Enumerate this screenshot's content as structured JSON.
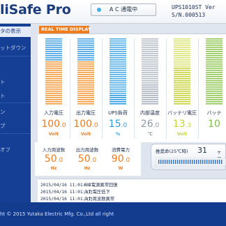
{
  "header": {
    "app_title": "liSafe Pro",
    "mode": "A C 通電中",
    "model_line1": "UPS1010ST  Ver",
    "model_line2": "S/N.000513"
  },
  "sidebar": {
    "items": [
      {
        "label": "タの表示",
        "active": true
      },
      {
        "label": "ットダウン",
        "active": false
      },
      {
        "label": "ト",
        "active": false
      },
      {
        "label": "ト",
        "active": false
      },
      {
        "label": "ン",
        "active": false
      },
      {
        "label": "プ",
        "active": false
      },
      {
        "label": "オフ",
        "active": false
      }
    ]
  },
  "realtime": {
    "title": "REAL TIME DISPLAY",
    "meters": [
      {
        "label": "入力電圧",
        "whole": "100",
        "dec": ".0",
        "unit": "Volt",
        "level": 0.66,
        "color": "#ef7b1c",
        "filled": "#f29a3b",
        "empty": "#1f8fdd"
      },
      {
        "label": "出力電圧",
        "whole": "100",
        "dec": ".0",
        "unit": "Volt",
        "level": 0.66,
        "color": "#ef7b1c",
        "filled": "#f29a3b",
        "empty": "#1f8fdd"
      },
      {
        "label": "UPS負荷",
        "whole": "15",
        "dec": ".0",
        "unit": "%",
        "level": 0.15,
        "color": "#2a9be0",
        "filled": "#2a9be0",
        "empty": "#2a9be0"
      },
      {
        "label": "内部温度",
        "whole": "26",
        "dec": ".0",
        "unit": "℃",
        "level": 0.3,
        "color": "#8d99a8",
        "filled": "#a7b1bd",
        "empty": "#a7b1bd"
      },
      {
        "label": "バッテリ電圧",
        "whole": "13",
        "dec": ".3",
        "unit": "Volt",
        "level": 0.55,
        "color": "#c7d431",
        "filled": "#c9d23a",
        "empty": "#d6df5a"
      },
      {
        "label": "バッテ",
        "whole": "10",
        "dec": "",
        "unit": "",
        "level": 1.0,
        "color": "#7fc043",
        "filled": "#8fc64f",
        "empty": "#8fc64f"
      }
    ]
  },
  "frequency": [
    {
      "label": "入力周波数",
      "whole": "50",
      "dec": ".0",
      "unit": "Hz"
    },
    {
      "label": "出力周波数",
      "whole": "50",
      "dec": ".0",
      "unit": "Hz"
    },
    {
      "label": "消費電力",
      "whole": "90",
      "dec": ".0",
      "unit": "W"
    }
  ],
  "battery_life": {
    "label": "推奨命(25℃時)",
    "value": "31",
    "unit": "ヶ月"
  },
  "log": [
    {
      "time": "2015/04/16 11:01:39",
      "message": "A C電源異常回復"
    },
    {
      "time": "2015/04/16 11:01:31",
      "message": "入力電圧低下"
    },
    {
      "time": "2015/04/16 11:01:31",
      "message": "入力周波数異常"
    }
  ],
  "footer": {
    "copyright": "ht © 2015 Yutaka Electric Mfg. Co.,Ltd all right"
  }
}
